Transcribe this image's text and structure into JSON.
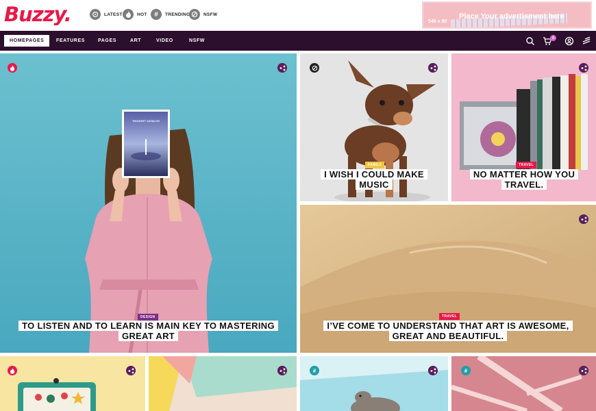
{
  "brand": {
    "logo": "Buzzy."
  },
  "quick_links": [
    {
      "label": "LATEST",
      "icon": "latest-icon"
    },
    {
      "label": "HOT",
      "icon": "flame-icon"
    },
    {
      "label": "TRENDING",
      "icon": "hashtag-icon"
    },
    {
      "label": "NSFW",
      "icon": "nsfw-icon"
    }
  ],
  "ad": {
    "text": "Place Your advertisment here",
    "size": "540 x 90"
  },
  "nav": {
    "items": [
      "HOMEPAGES",
      "FEATURES",
      "PAGES",
      "ART",
      "VIDEO",
      "NSFW"
    ],
    "cart_count": "0"
  },
  "cards": {
    "hero": {
      "category": "DESIGN",
      "title_line1": "TO LISTEN AND TO LEARN IS MAIN KEY TO MASTERING",
      "title_line2": "GREAT ART",
      "book_title": "THOUGHT CATALOG"
    },
    "dog": {
      "category": "FAMILY",
      "title_line1": "I WISH I COULD MAKE",
      "title_line2": "MUSIC"
    },
    "books": {
      "category": "TRAVEL",
      "title_line1": "NO MATTER HOW YOU",
      "title_line2": "TRAVEL."
    },
    "desert": {
      "category": "TRAVEL",
      "title_line1": "I’VE COME TO UNDERSTAND THAT ART IS AWESOME,",
      "title_line2": "GREAT AND BEAUTIFUL."
    }
  },
  "colors": {
    "brand": "#e8194a",
    "nav_bg": "#2c0f2c",
    "badge_purple": "#5a1e5c",
    "design_tag": "#7b2f85",
    "family_tag": "#f0c53f"
  }
}
